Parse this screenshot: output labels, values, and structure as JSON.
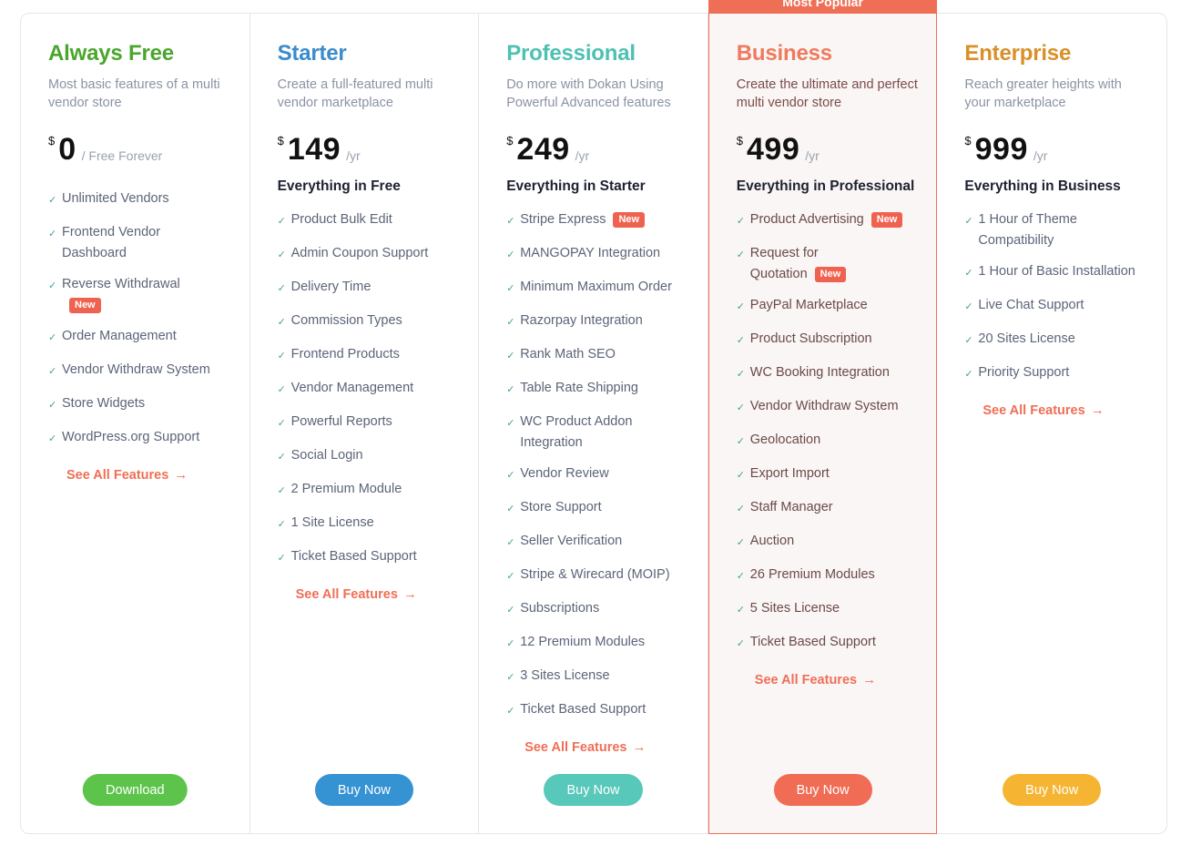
{
  "ribbon_label": "Most Popular",
  "see_all_label": "See All Features",
  "plans": [
    {
      "name": "Always Free",
      "color": "#4aa62d",
      "description": "Most basic features of a multi vendor store",
      "currency": "$",
      "amount": "0",
      "period": "/ Free Forever",
      "subhead": "",
      "features": [
        {
          "text": "Unlimited Vendors"
        },
        {
          "text": "Frontend Vendor Dashboard"
        },
        {
          "text": "Reverse Withdrawal",
          "badge": "New"
        },
        {
          "text": "Order Management"
        },
        {
          "text": "Vendor Withdraw System"
        },
        {
          "text": "Store Widgets"
        },
        {
          "text": "WordPress.org Support"
        }
      ],
      "cta_label": "Download",
      "cta_color": "#5cc44a"
    },
    {
      "name": "Starter",
      "color": "#3a8ccc",
      "description": "Create a full-featured multi vendor marketplace",
      "currency": "$",
      "amount": "149",
      "period": "/yr",
      "subhead": "Everything in Free",
      "features": [
        {
          "text": "Product Bulk Edit"
        },
        {
          "text": "Admin Coupon Support"
        },
        {
          "text": "Delivery Time"
        },
        {
          "text": "Commission Types"
        },
        {
          "text": "Frontend Products"
        },
        {
          "text": "Vendor Management"
        },
        {
          "text": "Powerful Reports"
        },
        {
          "text": "Social Login"
        },
        {
          "text": "2 Premium Module"
        },
        {
          "text": "1 Site License"
        },
        {
          "text": "Ticket Based Support"
        }
      ],
      "cta_label": "Buy Now",
      "cta_color": "#3592d3"
    },
    {
      "name": "Professional",
      "color": "#4ec1b3",
      "description": "Do more with Dokan Using Powerful Advanced features",
      "currency": "$",
      "amount": "249",
      "period": "/yr",
      "subhead": "Everything in Starter",
      "features": [
        {
          "text": "Stripe Express",
          "badge": "New"
        },
        {
          "text": "MANGOPAY Integration"
        },
        {
          "text": "Minimum Maximum Order"
        },
        {
          "text": "Razorpay Integration"
        },
        {
          "text": "Rank Math SEO"
        },
        {
          "text": "Table Rate Shipping"
        },
        {
          "text": "WC Product Addon Integration"
        },
        {
          "text": "Vendor Review"
        },
        {
          "text": "Store Support"
        },
        {
          "text": "Seller Verification"
        },
        {
          "text": "Stripe & Wirecard (MOIP)"
        },
        {
          "text": "Subscriptions"
        },
        {
          "text": "12 Premium Modules"
        },
        {
          "text": "3 Sites License"
        },
        {
          "text": "Ticket Based Support"
        }
      ],
      "cta_label": "Buy Now",
      "cta_color": "#58c8bb"
    },
    {
      "name": "Business",
      "color": "#ef7a5d",
      "description": "Create the ultimate and perfect multi vendor store",
      "currency": "$",
      "amount": "499",
      "period": "/yr",
      "subhead": "Everything in Professional",
      "popular": true,
      "features": [
        {
          "text": "Product Advertising",
          "badge": "New"
        },
        {
          "text": "Request for Quotation",
          "badge": "New"
        },
        {
          "text": "PayPal Marketplace"
        },
        {
          "text": "Product Subscription"
        },
        {
          "text": "WC Booking Integration"
        },
        {
          "text": "Vendor Withdraw System"
        },
        {
          "text": "Geolocation"
        },
        {
          "text": "Export Import"
        },
        {
          "text": "Staff Manager"
        },
        {
          "text": "Auction"
        },
        {
          "text": "26 Premium Modules"
        },
        {
          "text": "5 Sites License"
        },
        {
          "text": "Ticket Based Support"
        }
      ],
      "cta_label": "Buy Now",
      "cta_color": "#f06c55"
    },
    {
      "name": "Enterprise",
      "color": "#d99028",
      "description": "Reach greater heights with your marketplace",
      "currency": "$",
      "amount": "999",
      "period": "/yr",
      "subhead": "Everything in Business",
      "features": [
        {
          "text": "1 Hour of Theme Compatibility"
        },
        {
          "text": "1 Hour of Basic Installation"
        },
        {
          "text": "Live Chat Support"
        },
        {
          "text": "20 Sites License"
        },
        {
          "text": "Priority Support"
        }
      ],
      "cta_label": "Buy Now",
      "cta_color": "#f6b433"
    }
  ]
}
